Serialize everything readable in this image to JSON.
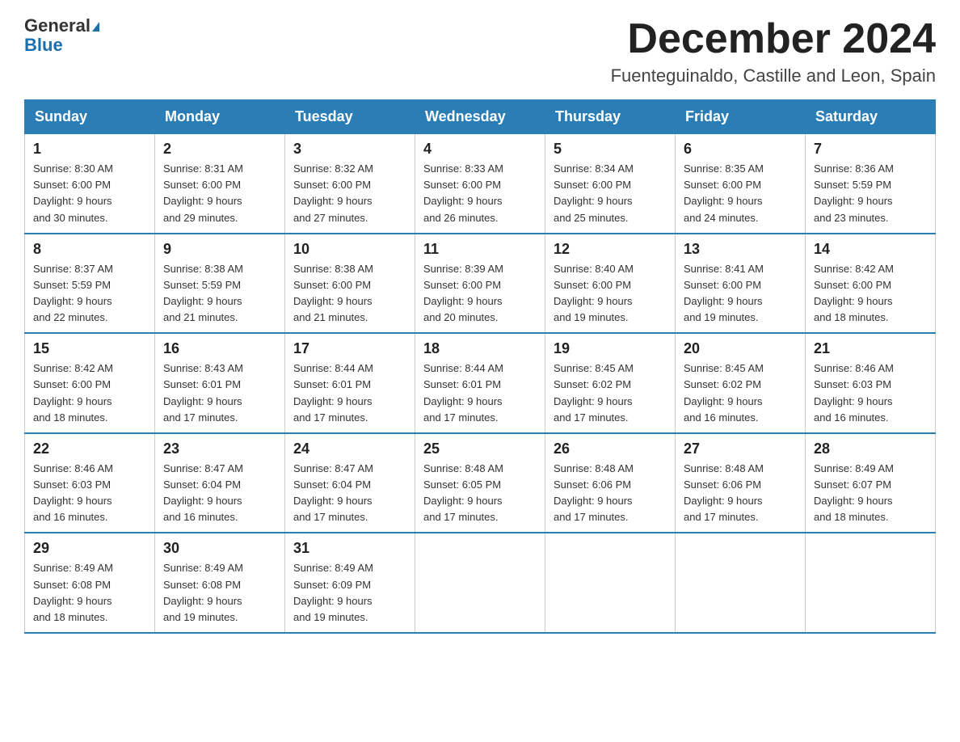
{
  "header": {
    "logo_general": "General",
    "logo_blue": "Blue",
    "month_title": "December 2024",
    "location": "Fuenteguinaldo, Castille and Leon, Spain"
  },
  "weekdays": [
    "Sunday",
    "Monday",
    "Tuesday",
    "Wednesday",
    "Thursday",
    "Friday",
    "Saturday"
  ],
  "weeks": [
    [
      {
        "day": "1",
        "sunrise": "8:30 AM",
        "sunset": "6:00 PM",
        "daylight": "9 hours and 30 minutes."
      },
      {
        "day": "2",
        "sunrise": "8:31 AM",
        "sunset": "6:00 PM",
        "daylight": "9 hours and 29 minutes."
      },
      {
        "day": "3",
        "sunrise": "8:32 AM",
        "sunset": "6:00 PM",
        "daylight": "9 hours and 27 minutes."
      },
      {
        "day": "4",
        "sunrise": "8:33 AM",
        "sunset": "6:00 PM",
        "daylight": "9 hours and 26 minutes."
      },
      {
        "day": "5",
        "sunrise": "8:34 AM",
        "sunset": "6:00 PM",
        "daylight": "9 hours and 25 minutes."
      },
      {
        "day": "6",
        "sunrise": "8:35 AM",
        "sunset": "6:00 PM",
        "daylight": "9 hours and 24 minutes."
      },
      {
        "day": "7",
        "sunrise": "8:36 AM",
        "sunset": "5:59 PM",
        "daylight": "9 hours and 23 minutes."
      }
    ],
    [
      {
        "day": "8",
        "sunrise": "8:37 AM",
        "sunset": "5:59 PM",
        "daylight": "9 hours and 22 minutes."
      },
      {
        "day": "9",
        "sunrise": "8:38 AM",
        "sunset": "5:59 PM",
        "daylight": "9 hours and 21 minutes."
      },
      {
        "day": "10",
        "sunrise": "8:38 AM",
        "sunset": "6:00 PM",
        "daylight": "9 hours and 21 minutes."
      },
      {
        "day": "11",
        "sunrise": "8:39 AM",
        "sunset": "6:00 PM",
        "daylight": "9 hours and 20 minutes."
      },
      {
        "day": "12",
        "sunrise": "8:40 AM",
        "sunset": "6:00 PM",
        "daylight": "9 hours and 19 minutes."
      },
      {
        "day": "13",
        "sunrise": "8:41 AM",
        "sunset": "6:00 PM",
        "daylight": "9 hours and 19 minutes."
      },
      {
        "day": "14",
        "sunrise": "8:42 AM",
        "sunset": "6:00 PM",
        "daylight": "9 hours and 18 minutes."
      }
    ],
    [
      {
        "day": "15",
        "sunrise": "8:42 AM",
        "sunset": "6:00 PM",
        "daylight": "9 hours and 18 minutes."
      },
      {
        "day": "16",
        "sunrise": "8:43 AM",
        "sunset": "6:01 PM",
        "daylight": "9 hours and 17 minutes."
      },
      {
        "day": "17",
        "sunrise": "8:44 AM",
        "sunset": "6:01 PM",
        "daylight": "9 hours and 17 minutes."
      },
      {
        "day": "18",
        "sunrise": "8:44 AM",
        "sunset": "6:01 PM",
        "daylight": "9 hours and 17 minutes."
      },
      {
        "day": "19",
        "sunrise": "8:45 AM",
        "sunset": "6:02 PM",
        "daylight": "9 hours and 17 minutes."
      },
      {
        "day": "20",
        "sunrise": "8:45 AM",
        "sunset": "6:02 PM",
        "daylight": "9 hours and 16 minutes."
      },
      {
        "day": "21",
        "sunrise": "8:46 AM",
        "sunset": "6:03 PM",
        "daylight": "9 hours and 16 minutes."
      }
    ],
    [
      {
        "day": "22",
        "sunrise": "8:46 AM",
        "sunset": "6:03 PM",
        "daylight": "9 hours and 16 minutes."
      },
      {
        "day": "23",
        "sunrise": "8:47 AM",
        "sunset": "6:04 PM",
        "daylight": "9 hours and 16 minutes."
      },
      {
        "day": "24",
        "sunrise": "8:47 AM",
        "sunset": "6:04 PM",
        "daylight": "9 hours and 17 minutes."
      },
      {
        "day": "25",
        "sunrise": "8:48 AM",
        "sunset": "6:05 PM",
        "daylight": "9 hours and 17 minutes."
      },
      {
        "day": "26",
        "sunrise": "8:48 AM",
        "sunset": "6:06 PM",
        "daylight": "9 hours and 17 minutes."
      },
      {
        "day": "27",
        "sunrise": "8:48 AM",
        "sunset": "6:06 PM",
        "daylight": "9 hours and 17 minutes."
      },
      {
        "day": "28",
        "sunrise": "8:49 AM",
        "sunset": "6:07 PM",
        "daylight": "9 hours and 18 minutes."
      }
    ],
    [
      {
        "day": "29",
        "sunrise": "8:49 AM",
        "sunset": "6:08 PM",
        "daylight": "9 hours and 18 minutes."
      },
      {
        "day": "30",
        "sunrise": "8:49 AM",
        "sunset": "6:08 PM",
        "daylight": "9 hours and 19 minutes."
      },
      {
        "day": "31",
        "sunrise": "8:49 AM",
        "sunset": "6:09 PM",
        "daylight": "9 hours and 19 minutes."
      },
      null,
      null,
      null,
      null
    ]
  ],
  "labels": {
    "sunrise": "Sunrise:",
    "sunset": "Sunset:",
    "daylight": "Daylight:"
  }
}
